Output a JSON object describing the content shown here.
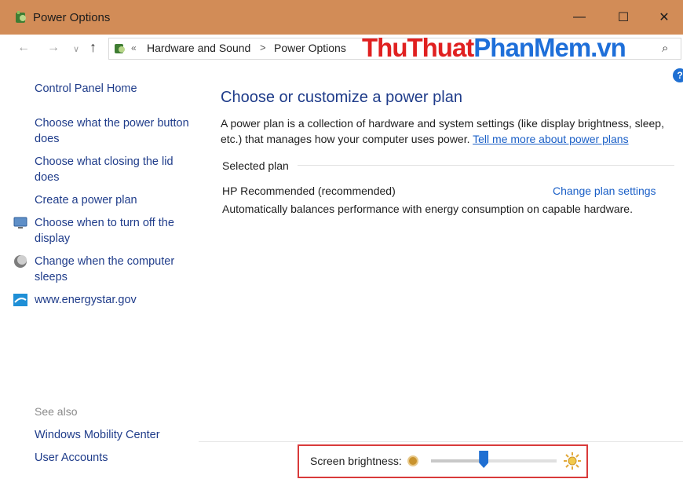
{
  "window": {
    "title": "Power Options",
    "controls": {
      "minimize": "—",
      "maximize": "☐",
      "close": "✕"
    }
  },
  "nav": {
    "back": "←",
    "forward": "→",
    "recent": "∨",
    "up": "↑",
    "overflow": "«",
    "breadcrumbs": [
      "Hardware and Sound",
      "Power Options"
    ],
    "separator": ">",
    "search_glyph": "⌕"
  },
  "watermark": {
    "part1": "ThuThuat",
    "part2": "PhanMem.vn"
  },
  "left_pane": {
    "home": "Control Panel Home",
    "links": [
      "Choose what the power button does",
      "Choose what closing the lid does",
      "Create a power plan",
      "Choose when to turn off the display",
      "Change when the computer sleeps",
      "www.energystar.gov"
    ],
    "see_also": {
      "heading": "See also",
      "links": [
        "Windows Mobility Center",
        "User Accounts"
      ]
    }
  },
  "main": {
    "title": "Choose or customize a power plan",
    "description": "A power plan is a collection of hardware and system settings (like display brightness, sleep, etc.) that manages how your computer uses power. ",
    "description_link": "Tell me more about power plans",
    "section_label": "Selected plan",
    "plan": {
      "name": "HP Recommended (recommended)",
      "change_link": "Change plan settings",
      "description": "Automatically balances performance with energy consumption on capable hardware."
    },
    "help_glyph": "?"
  },
  "brightness": {
    "label": "Screen brightness:",
    "level_percent": 42
  },
  "colors": {
    "titlebar": "#d28c57",
    "link": "#1f3c8a",
    "accent": "#1f6fd2",
    "highlight_border": "#d93a3a"
  }
}
